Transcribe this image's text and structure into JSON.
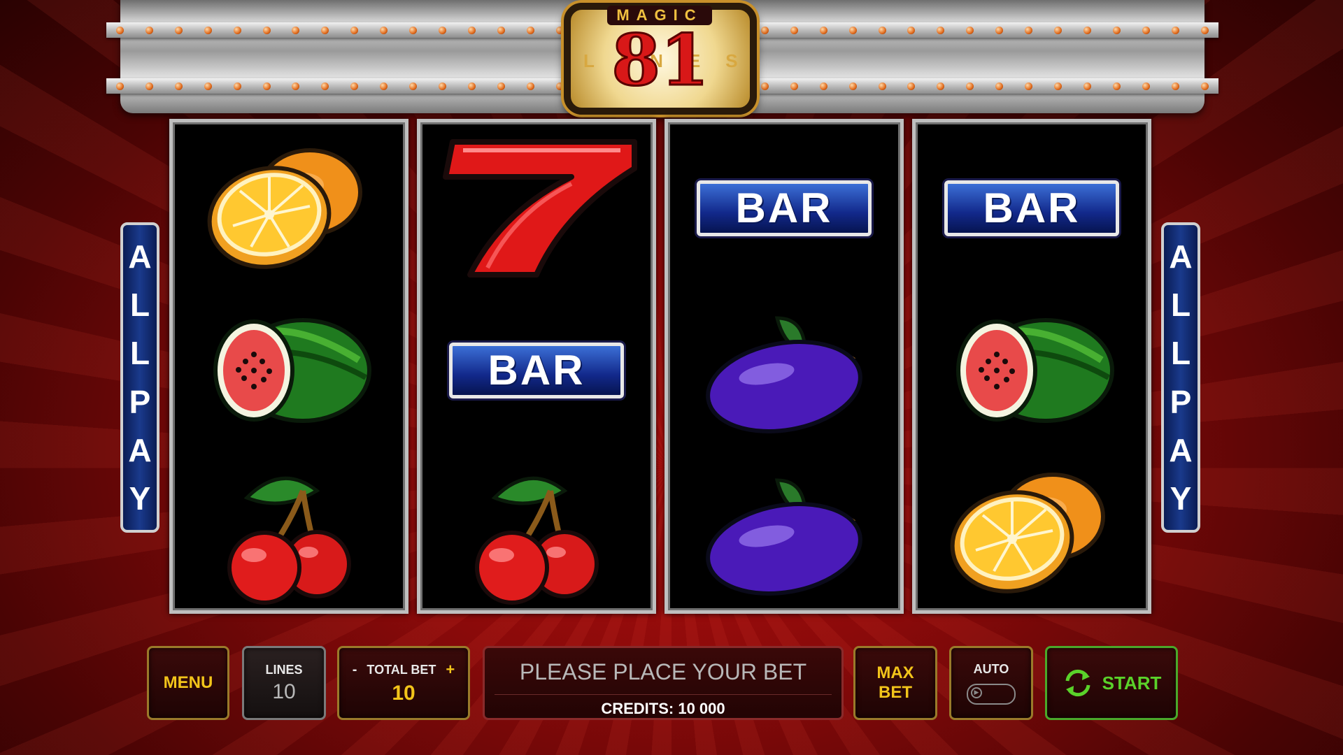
{
  "marquee": {
    "logo_top": "MAGIC",
    "logo_number": "81",
    "logo_word": "LINES"
  },
  "side_panels": {
    "left_letters": [
      "A",
      "L",
      "L",
      "P",
      "A",
      "Y"
    ],
    "right_letters": [
      "A",
      "L",
      "L",
      "P",
      "A",
      "Y"
    ]
  },
  "reels": [
    {
      "symbols": [
        "orange",
        "watermelon",
        "cherries"
      ]
    },
    {
      "symbols": [
        "seven",
        "bar",
        "cherries"
      ]
    },
    {
      "symbols": [
        "bar",
        "plum",
        "plum"
      ]
    },
    {
      "symbols": [
        "bar",
        "watermelon",
        "orange"
      ]
    }
  ],
  "bar_label": "BAR",
  "controls": {
    "menu_label": "MENU",
    "lines_label": "LINES",
    "lines_value": "10",
    "total_bet_minus": "-",
    "total_bet_label": "TOTAL BET",
    "total_bet_plus": "+",
    "total_bet_value": "10",
    "message": "PLEASE PLACE YOUR BET",
    "credits": "CREDITS: 10 000",
    "max_bet_line1": "MAX",
    "max_bet_line2": "BET",
    "auto_label": "AUTO",
    "auto_toggle_on": false,
    "start_label": "START"
  },
  "colors": {
    "accent_gold": "#f2c41a",
    "start_green": "#5ad22a",
    "background_red": "#b3100e"
  }
}
